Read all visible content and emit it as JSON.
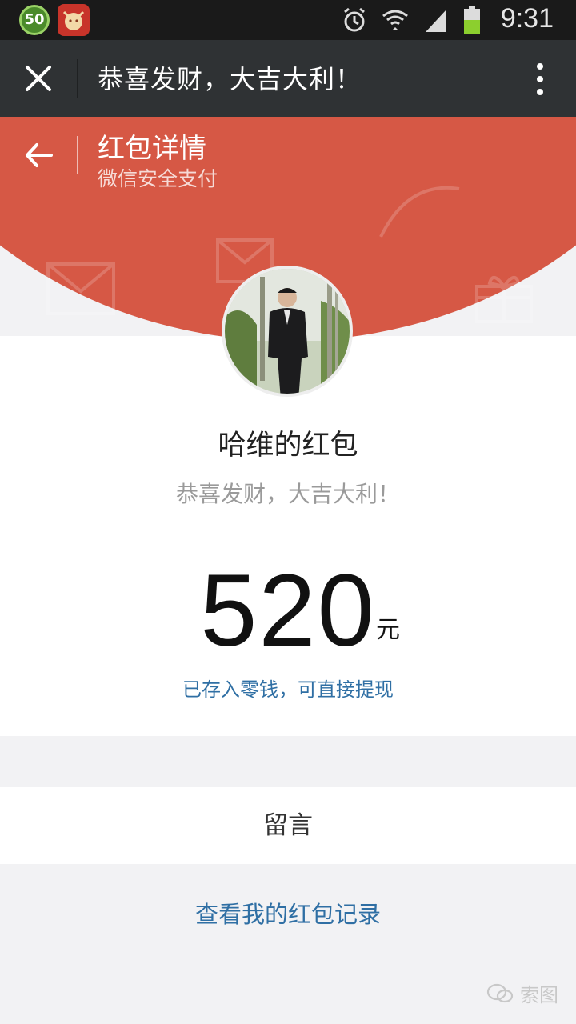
{
  "status_bar": {
    "badge": "50",
    "time": "9:31",
    "icons": [
      "alarm-icon",
      "wifi-icon",
      "signal-icon",
      "battery-icon"
    ]
  },
  "title_bar": {
    "title": "恭喜发财，大吉大利！"
  },
  "header": {
    "title": "红包详情",
    "subtitle": "微信安全支付"
  },
  "packet": {
    "sender": "哈维的红包",
    "wish": "恭喜发财，大吉大利！",
    "amount": "520",
    "unit": "元",
    "note": "已存入零钱，可直接提现"
  },
  "actions": {
    "message": "留言",
    "records": "查看我的红包记录"
  },
  "watermark": {
    "text": "索图"
  },
  "colors": {
    "red": "#d65845",
    "titlebar": "#2f3234",
    "link": "#2f6fa4"
  }
}
